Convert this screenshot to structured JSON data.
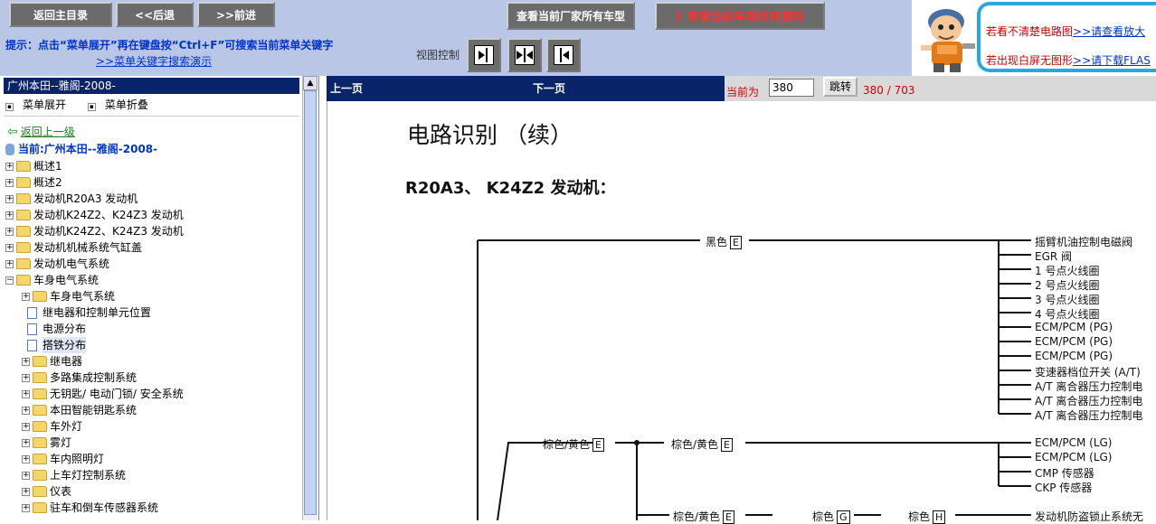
{
  "topbar": {
    "nav_buttons": [
      "返回主目录",
      "<<后退",
      ">>前进"
    ],
    "all_models_button": "查看当前厂家所有车型",
    "all_data_button": "》查看当前车型所有资料",
    "hint": "提示：点击“菜单展开”再在键盘按“Ctrl+F”可搜索当前菜单关键字",
    "hint_link": ">>菜单关键字搜索演示",
    "view_control_label": "视图控制",
    "notice_line1_text": "若看不清楚电路图",
    "notice_line1_link": ">>请查看放大",
    "notice_line2_text": "若出现白屏无图形",
    "notice_line2_link": ">>请下载FLAS"
  },
  "left_panel": {
    "title": "广州本田--雅阁-2008-",
    "expand_menu": "菜单展开",
    "collapse_menu": "菜单折叠",
    "back_up": "返回上一级",
    "current": "当前:广州本田--雅阁-2008-",
    "tree": [
      {
        "label": "概述1",
        "level": 0,
        "kind": "folder",
        "expanded": false
      },
      {
        "label": "概述2",
        "level": 0,
        "kind": "folder",
        "expanded": false
      },
      {
        "label": "发动机R20A3 发动机",
        "level": 0,
        "kind": "folder",
        "expanded": false
      },
      {
        "label": "发动机K24Z2、K24Z3 发动机",
        "level": 0,
        "kind": "folder",
        "expanded": false
      },
      {
        "label": "发动机K24Z2、K24Z3 发动机",
        "level": 0,
        "kind": "folder",
        "expanded": false
      },
      {
        "label": "发动机机械系统气缸盖",
        "level": 0,
        "kind": "folder",
        "expanded": false
      },
      {
        "label": "发动机电气系统",
        "level": 0,
        "kind": "folder",
        "expanded": false
      },
      {
        "label": "车身电气系统",
        "level": 0,
        "kind": "folder",
        "expanded": true
      },
      {
        "label": "车身电气系统",
        "level": 1,
        "kind": "folder",
        "expanded": false
      },
      {
        "label": "继电器和控制单元位置",
        "level": 1,
        "kind": "doc"
      },
      {
        "label": "电源分布",
        "level": 1,
        "kind": "doc"
      },
      {
        "label": "搭铁分布",
        "level": 1,
        "kind": "doc",
        "selected": true
      },
      {
        "label": "继电器",
        "level": 1,
        "kind": "folder",
        "expanded": false
      },
      {
        "label": "多路集成控制系统",
        "level": 1,
        "kind": "folder",
        "expanded": false
      },
      {
        "label": "无钥匙/ 电动门锁/ 安全系统",
        "level": 1,
        "kind": "folder",
        "expanded": false
      },
      {
        "label": "本田智能钥匙系统",
        "level": 1,
        "kind": "folder",
        "expanded": false
      },
      {
        "label": "车外灯",
        "level": 1,
        "kind": "folder",
        "expanded": false
      },
      {
        "label": "雾灯",
        "level": 1,
        "kind": "folder",
        "expanded": false
      },
      {
        "label": "车内照明灯",
        "level": 1,
        "kind": "folder",
        "expanded": false
      },
      {
        "label": "上车灯控制系统",
        "level": 1,
        "kind": "folder",
        "expanded": false
      },
      {
        "label": "仪表",
        "level": 1,
        "kind": "folder",
        "expanded": false
      },
      {
        "label": "驻车和倒车传感器系统",
        "level": 1,
        "kind": "folder",
        "expanded": false
      }
    ]
  },
  "pager": {
    "prev": "上一页",
    "next": "下一页",
    "current_label": "当前为",
    "page_value": "380",
    "jump": "跳转",
    "count": "380 / 703"
  },
  "diagram": {
    "title": "电路识别 （续）",
    "subtitle": "R20A3、 K24Z2 发动机：",
    "wire_black": "黑色",
    "wire_brown_yellow": "棕色/黄色",
    "wire_brown": "棕色",
    "conn_e": "E",
    "conn_g": "G",
    "conn_h": "H",
    "components_group1": [
      "摇臂机油控制电磁阀",
      "EGR 阀",
      "1 号点火线圈",
      "2 号点火线圈",
      "3 号点火线圈",
      "4 号点火线圈",
      "ECM/PCM (PG)",
      "ECM/PCM (PG)",
      "ECM/PCM (PG)",
      "变速器档位开关 (A/T)",
      "A/T 离合器压力控制电",
      "A/T 离合器压力控制电",
      "A/T 离合器压力控制电"
    ],
    "components_group2": [
      "ECM/PCM (LG)",
      "ECM/PCM (LG)",
      "CMP 传感器",
      "CKP 传感器"
    ],
    "component_bottom": "发动机防盗锁止系统无"
  },
  "colors": {
    "accent_blue": "#0a246a",
    "link_blue": "#0033cc",
    "alert_red": "#d00000",
    "topbar_bg": "#b9c6e6"
  }
}
